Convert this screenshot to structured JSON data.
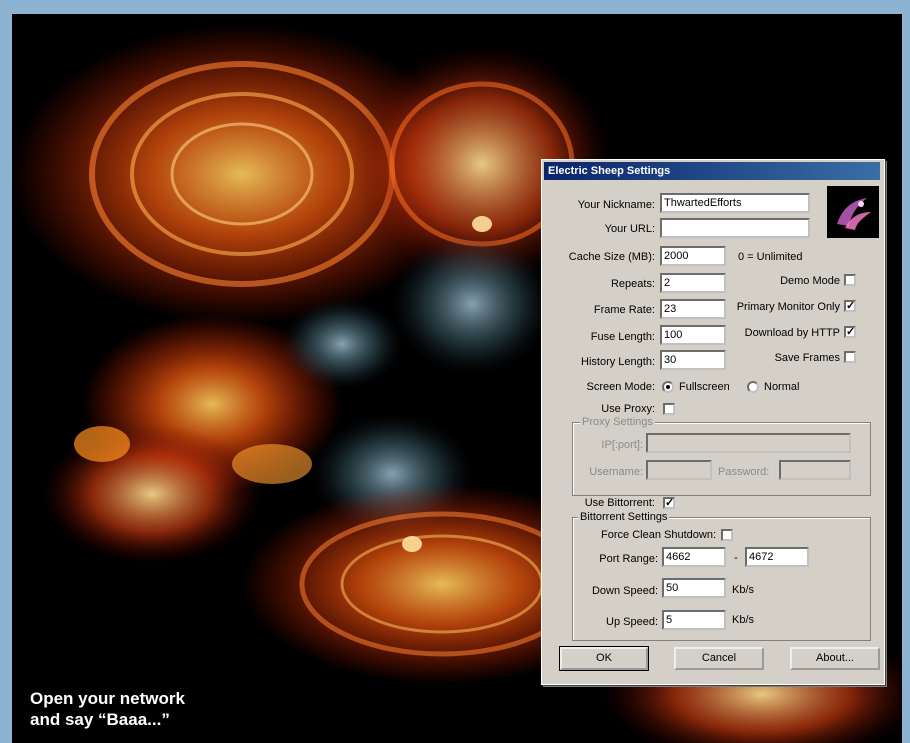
{
  "dialog": {
    "title": "Electric Sheep Settings",
    "nickname_label": "Your Nickname:",
    "nickname_value": "ThwartedEfforts",
    "url_label": "Your URL:",
    "url_value": "",
    "cache_label": "Cache Size (MB):",
    "cache_value": "2000",
    "cache_note": "0 = Unlimited",
    "repeats_label": "Repeats:",
    "repeats_value": "2",
    "framerate_label": "Frame Rate:",
    "framerate_value": "23",
    "fuse_label": "Fuse Length:",
    "fuse_value": "100",
    "history_label": "History Length:",
    "history_value": "30",
    "demo_mode_label": "Demo Mode",
    "primary_monitor_label": "Primary Monitor Only",
    "download_http_label": "Download by HTTP",
    "save_frames_label": "Save Frames",
    "screen_mode_label": "Screen Mode:",
    "fullscreen_label": "Fullscreen",
    "normal_label": "Normal",
    "use_proxy_label": "Use Proxy:",
    "proxy_group_label": "Proxy Settings",
    "ip_port_label": "IP[:port]:",
    "username_label": "Username:",
    "password_label": "Password:",
    "use_bittorrent_label": "Use Bittorrent:",
    "bittorrent_group_label": "Bittorrent Settings",
    "force_clean_label": "Force Clean Shutdown:",
    "port_range_label": "Port Range:",
    "port_from": "4662",
    "port_dash": "-",
    "port_to": "4672",
    "down_speed_label": "Down Speed:",
    "down_speed_value": "50",
    "up_speed_label": "Up Speed:",
    "up_speed_value": "5",
    "kbs_unit": "Kb/s",
    "ok_label": "OK",
    "cancel_label": "Cancel",
    "about_label": "About...",
    "checks": {
      "demo_mode": false,
      "primary_monitor": true,
      "download_http": true,
      "save_frames": false,
      "use_proxy": false,
      "use_bittorrent": true,
      "force_clean": false
    },
    "screen_mode": "Fullscreen"
  },
  "caption": {
    "line1": "Open your network",
    "line2": "and say “Baaa...”"
  },
  "colors": {
    "title_bar": "#0a246a",
    "dialog_bg": "#d4d0c8",
    "art_bg": "#000000",
    "flame_orange": "#ff5a10",
    "flame_yellow": "#ffc040",
    "frame_blue": "#8cb3d2"
  },
  "icons": {
    "logo": "electric-sheep-logo",
    "check": "check-mark-icon"
  }
}
